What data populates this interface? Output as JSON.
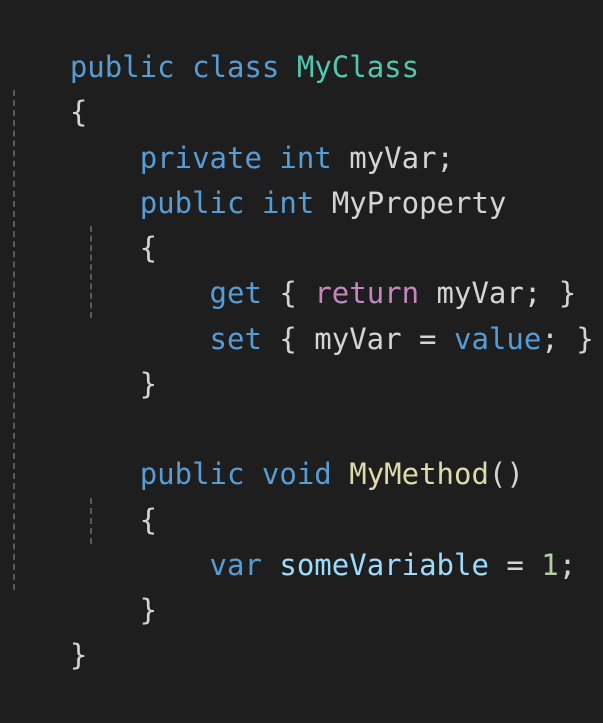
{
  "code": {
    "lines": [
      {
        "tokens": [
          {
            "text": "public",
            "cls": "kw"
          },
          {
            "text": " ",
            "cls": "txt"
          },
          {
            "text": "class",
            "cls": "kw"
          },
          {
            "text": " ",
            "cls": "txt"
          },
          {
            "text": "MyClass",
            "cls": "type"
          }
        ]
      },
      {
        "tokens": [
          {
            "text": "{",
            "cls": "txt"
          }
        ]
      },
      {
        "tokens": [
          {
            "text": "    ",
            "cls": "txt"
          },
          {
            "text": "private",
            "cls": "kw"
          },
          {
            "text": " ",
            "cls": "txt"
          },
          {
            "text": "int",
            "cls": "kw"
          },
          {
            "text": " myVar;",
            "cls": "txt"
          }
        ]
      },
      {
        "tokens": [
          {
            "text": "    ",
            "cls": "txt"
          },
          {
            "text": "public",
            "cls": "kw"
          },
          {
            "text": " ",
            "cls": "txt"
          },
          {
            "text": "int",
            "cls": "kw"
          },
          {
            "text": " MyProperty",
            "cls": "txt"
          }
        ]
      },
      {
        "tokens": [
          {
            "text": "    {",
            "cls": "txt"
          }
        ]
      },
      {
        "tokens": [
          {
            "text": "        ",
            "cls": "txt"
          },
          {
            "text": "get",
            "cls": "kw"
          },
          {
            "text": " { ",
            "cls": "txt"
          },
          {
            "text": "return",
            "cls": "ctrl"
          },
          {
            "text": " myVar; }",
            "cls": "txt"
          }
        ]
      },
      {
        "tokens": [
          {
            "text": "        ",
            "cls": "txt"
          },
          {
            "text": "set",
            "cls": "kw"
          },
          {
            "text": " { myVar = ",
            "cls": "txt"
          },
          {
            "text": "value",
            "cls": "kw"
          },
          {
            "text": "; }",
            "cls": "txt"
          }
        ]
      },
      {
        "tokens": [
          {
            "text": "    }",
            "cls": "txt"
          }
        ]
      },
      {
        "tokens": [
          {
            "text": "",
            "cls": "txt"
          }
        ]
      },
      {
        "tokens": [
          {
            "text": "    ",
            "cls": "txt"
          },
          {
            "text": "public",
            "cls": "kw"
          },
          {
            "text": " ",
            "cls": "txt"
          },
          {
            "text": "void",
            "cls": "kw"
          },
          {
            "text": " ",
            "cls": "txt"
          },
          {
            "text": "MyMethod",
            "cls": "method"
          },
          {
            "text": "()",
            "cls": "txt"
          }
        ]
      },
      {
        "tokens": [
          {
            "text": "    {",
            "cls": "txt"
          }
        ]
      },
      {
        "tokens": [
          {
            "text": "        ",
            "cls": "txt"
          },
          {
            "text": "var",
            "cls": "kw"
          },
          {
            "text": " ",
            "cls": "txt"
          },
          {
            "text": "someVariable",
            "cls": "var"
          },
          {
            "text": " = ",
            "cls": "txt"
          },
          {
            "text": "1",
            "cls": "num"
          },
          {
            "text": ";",
            "cls": "txt"
          }
        ]
      },
      {
        "tokens": [
          {
            "text": "    }",
            "cls": "txt"
          }
        ]
      },
      {
        "tokens": [
          {
            "text": "}",
            "cls": "txt"
          }
        ]
      }
    ]
  },
  "colors": {
    "background": "#1e1e1e",
    "keyword": "#569cd6",
    "type": "#4ec9b0",
    "control": "#c586c0",
    "method": "#dcdcaa",
    "variable": "#9cdcfe",
    "number": "#b5cea8",
    "text": "#d4d4d4",
    "guide": "#5a5a5a"
  }
}
